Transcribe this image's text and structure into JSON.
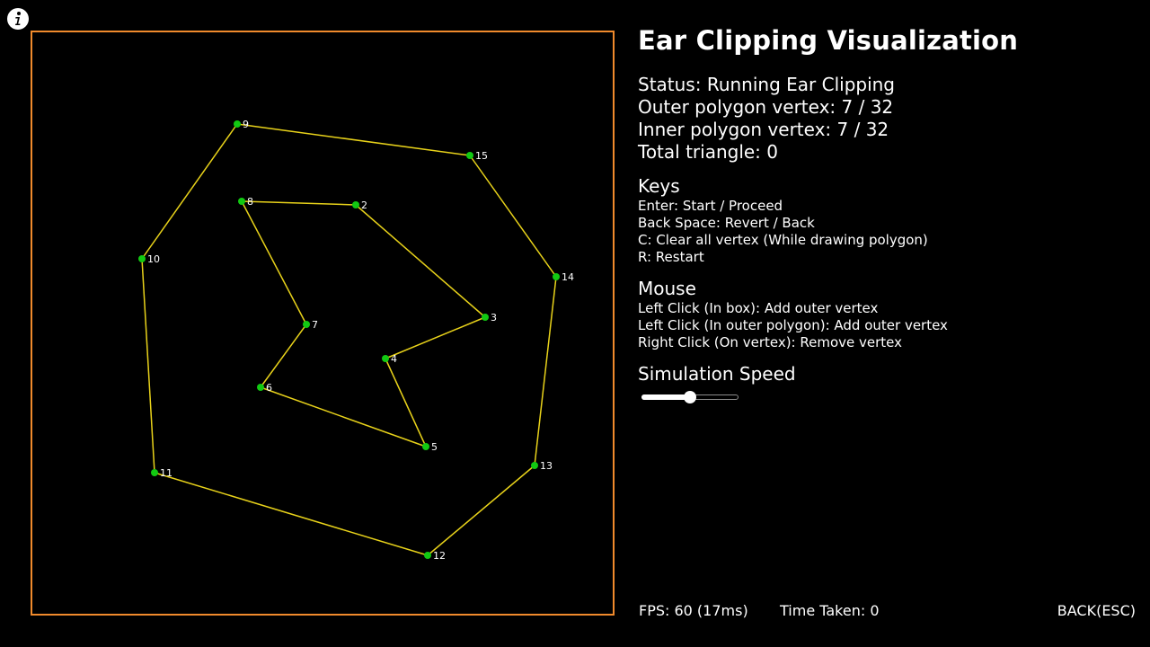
{
  "colors": {
    "background": "#000000",
    "canvas_border": "#f08a2c",
    "edge": "#e8d21a",
    "vertex": "#12c912",
    "text": "#ffffff"
  },
  "icons": {
    "info": "info-icon"
  },
  "title": "Ear Clipping Visualization",
  "status": {
    "status": "Status: Running Ear Clipping",
    "outer": "Outer polygon vertex: 7 / 32",
    "inner": "Inner polygon vertex: 7 / 32",
    "triangles": "Total triangle: 0"
  },
  "keys": {
    "heading": "Keys",
    "items": [
      "Enter: Start / Proceed",
      "Back Space: Revert / Back",
      "C: Clear all vertex (While drawing polygon)",
      "R: Restart"
    ]
  },
  "mouse": {
    "heading": "Mouse",
    "items": [
      "Left Click (In box): Add outer vertex",
      "Left Click (In outer polygon): Add outer vertex",
      "Right Click (On vertex): Remove vertex"
    ]
  },
  "speed": {
    "heading": "Simulation Speed",
    "value": 0.5
  },
  "footer": {
    "fps": "FPS: 60 (17ms)",
    "time": "Time Taken: 0",
    "back": "BACK(ESC)"
  },
  "polygons": {
    "outer_labels": [
      "9",
      "15",
      "14",
      "13",
      "12",
      "11",
      "10"
    ],
    "inner_labels": [
      "8",
      "2",
      "3",
      "4",
      "5",
      "6",
      "7"
    ]
  }
}
